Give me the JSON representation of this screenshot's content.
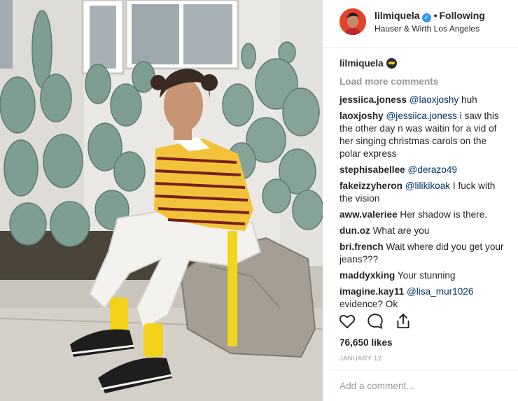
{
  "header": {
    "username": "lilmiquela",
    "verified_icon": "verified-badge-icon",
    "separator": "•",
    "follow_status": "Following",
    "location": "Hauser & Wirth Los Angeles"
  },
  "caption": {
    "username": "lilmiquela",
    "emoji_icon": "bee-emoji-icon"
  },
  "load_more": "Load more comments",
  "comments": [
    {
      "user": "jessiica.joness",
      "mention": "@laoxjoshy",
      "text": " huh"
    },
    {
      "user": "laoxjoshy",
      "mention": "@jessiica.joness",
      "text": " i saw this the other day n was waitin for a vid of her singing christmas carols on the polar express"
    },
    {
      "user": "stephisabellee",
      "mention": "@derazo49",
      "text": ""
    },
    {
      "user": "fakeizzyheron",
      "mention": "@lilikikoak",
      "text": " I fuck with the vision"
    },
    {
      "user": "aww.valeriee",
      "mention": "",
      "text": " Her shadow is there."
    },
    {
      "user": "dun.oz",
      "mention": "",
      "text": " What are you"
    },
    {
      "user": "bri.french",
      "mention": "",
      "text": " Wait where did you get your jeans???"
    },
    {
      "user": "maddyxking",
      "mention": "",
      "text": " Your stunning"
    },
    {
      "user": "imagine.kay11",
      "mention": "@lisa_mur1026",
      "text": " evidence? Ok"
    }
  ],
  "actions": {
    "like_icon": "heart-icon",
    "comment_icon": "comment-bubble-icon",
    "share_icon": "share-icon"
  },
  "likes": "76,650 likes",
  "date": "JANUARY 12",
  "add_comment": {
    "placeholder": "Add a comment..."
  },
  "colors": {
    "accent_link": "#003569",
    "verified_blue": "#3897f0",
    "muted_text": "#999999",
    "shirt_yellow": "#f2c33a",
    "shirt_stripe": "#7a1f1f"
  }
}
